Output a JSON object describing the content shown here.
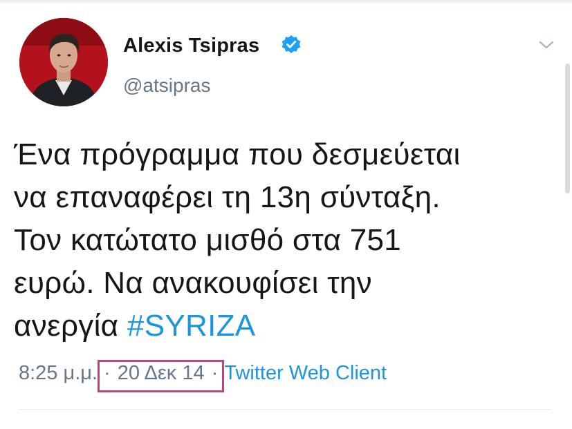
{
  "user": {
    "display_name": "Alexis Tsipras",
    "handle": "@atsipras",
    "verified": true
  },
  "tweet": {
    "lines": [
      "Ένα πρόγραμμα που δεσμεύεται",
      "να επαναφέρει τη 13η σύνταξη.",
      "Τον κατώτατο μισθό στα 751",
      "ευρώ. Να ανακουφίσει την",
      "ανεργία "
    ],
    "hashtag": "#SYRIZA"
  },
  "meta": {
    "time": "8:25 μ.μ.",
    "separator": "·",
    "date": "20 Δεκ 14",
    "client": "Twitter Web Client"
  },
  "icons": {
    "verified": "verified-badge-icon",
    "menu": "chevron-down-icon"
  },
  "colors": {
    "link": "#1b95e0",
    "secondary_text": "#657786",
    "primary_text": "#14171a",
    "highlight_box": "#c0427a",
    "avatar_background": "#b3121c"
  }
}
